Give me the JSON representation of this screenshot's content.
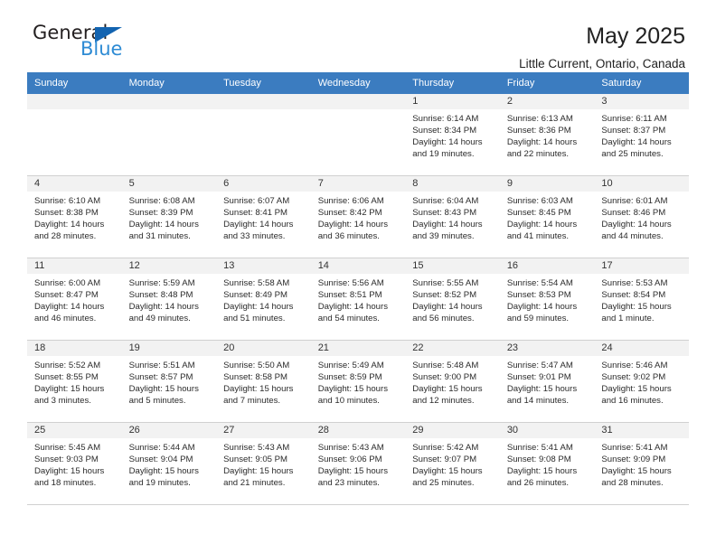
{
  "brand": {
    "name_part1": "General",
    "name_part2": "Blue",
    "triangle_color": "#1263b0",
    "blue_color": "#2e8bd4"
  },
  "header": {
    "title": "May 2025",
    "subtitle": "Little Current, Ontario, Canada"
  },
  "theme": {
    "header_row_bg": "#3b7cc0",
    "daynum_bg": "#f2f2f2",
    "grid_line": "#d0d0d0"
  },
  "weekday_headers": [
    "Sunday",
    "Monday",
    "Tuesday",
    "Wednesday",
    "Thursday",
    "Friday",
    "Saturday"
  ],
  "weeks": [
    [
      {
        "day": "",
        "sunrise": "",
        "sunset": "",
        "daylight1": "",
        "daylight2": ""
      },
      {
        "day": "",
        "sunrise": "",
        "sunset": "",
        "daylight1": "",
        "daylight2": ""
      },
      {
        "day": "",
        "sunrise": "",
        "sunset": "",
        "daylight1": "",
        "daylight2": ""
      },
      {
        "day": "",
        "sunrise": "",
        "sunset": "",
        "daylight1": "",
        "daylight2": ""
      },
      {
        "day": "1",
        "sunrise": "Sunrise: 6:14 AM",
        "sunset": "Sunset: 8:34 PM",
        "daylight1": "Daylight: 14 hours",
        "daylight2": "and 19 minutes."
      },
      {
        "day": "2",
        "sunrise": "Sunrise: 6:13 AM",
        "sunset": "Sunset: 8:36 PM",
        "daylight1": "Daylight: 14 hours",
        "daylight2": "and 22 minutes."
      },
      {
        "day": "3",
        "sunrise": "Sunrise: 6:11 AM",
        "sunset": "Sunset: 8:37 PM",
        "daylight1": "Daylight: 14 hours",
        "daylight2": "and 25 minutes."
      }
    ],
    [
      {
        "day": "4",
        "sunrise": "Sunrise: 6:10 AM",
        "sunset": "Sunset: 8:38 PM",
        "daylight1": "Daylight: 14 hours",
        "daylight2": "and 28 minutes."
      },
      {
        "day": "5",
        "sunrise": "Sunrise: 6:08 AM",
        "sunset": "Sunset: 8:39 PM",
        "daylight1": "Daylight: 14 hours",
        "daylight2": "and 31 minutes."
      },
      {
        "day": "6",
        "sunrise": "Sunrise: 6:07 AM",
        "sunset": "Sunset: 8:41 PM",
        "daylight1": "Daylight: 14 hours",
        "daylight2": "and 33 minutes."
      },
      {
        "day": "7",
        "sunrise": "Sunrise: 6:06 AM",
        "sunset": "Sunset: 8:42 PM",
        "daylight1": "Daylight: 14 hours",
        "daylight2": "and 36 minutes."
      },
      {
        "day": "8",
        "sunrise": "Sunrise: 6:04 AM",
        "sunset": "Sunset: 8:43 PM",
        "daylight1": "Daylight: 14 hours",
        "daylight2": "and 39 minutes."
      },
      {
        "day": "9",
        "sunrise": "Sunrise: 6:03 AM",
        "sunset": "Sunset: 8:45 PM",
        "daylight1": "Daylight: 14 hours",
        "daylight2": "and 41 minutes."
      },
      {
        "day": "10",
        "sunrise": "Sunrise: 6:01 AM",
        "sunset": "Sunset: 8:46 PM",
        "daylight1": "Daylight: 14 hours",
        "daylight2": "and 44 minutes."
      }
    ],
    [
      {
        "day": "11",
        "sunrise": "Sunrise: 6:00 AM",
        "sunset": "Sunset: 8:47 PM",
        "daylight1": "Daylight: 14 hours",
        "daylight2": "and 46 minutes."
      },
      {
        "day": "12",
        "sunrise": "Sunrise: 5:59 AM",
        "sunset": "Sunset: 8:48 PM",
        "daylight1": "Daylight: 14 hours",
        "daylight2": "and 49 minutes."
      },
      {
        "day": "13",
        "sunrise": "Sunrise: 5:58 AM",
        "sunset": "Sunset: 8:49 PM",
        "daylight1": "Daylight: 14 hours",
        "daylight2": "and 51 minutes."
      },
      {
        "day": "14",
        "sunrise": "Sunrise: 5:56 AM",
        "sunset": "Sunset: 8:51 PM",
        "daylight1": "Daylight: 14 hours",
        "daylight2": "and 54 minutes."
      },
      {
        "day": "15",
        "sunrise": "Sunrise: 5:55 AM",
        "sunset": "Sunset: 8:52 PM",
        "daylight1": "Daylight: 14 hours",
        "daylight2": "and 56 minutes."
      },
      {
        "day": "16",
        "sunrise": "Sunrise: 5:54 AM",
        "sunset": "Sunset: 8:53 PM",
        "daylight1": "Daylight: 14 hours",
        "daylight2": "and 59 minutes."
      },
      {
        "day": "17",
        "sunrise": "Sunrise: 5:53 AM",
        "sunset": "Sunset: 8:54 PM",
        "daylight1": "Daylight: 15 hours",
        "daylight2": "and 1 minute."
      }
    ],
    [
      {
        "day": "18",
        "sunrise": "Sunrise: 5:52 AM",
        "sunset": "Sunset: 8:55 PM",
        "daylight1": "Daylight: 15 hours",
        "daylight2": "and 3 minutes."
      },
      {
        "day": "19",
        "sunrise": "Sunrise: 5:51 AM",
        "sunset": "Sunset: 8:57 PM",
        "daylight1": "Daylight: 15 hours",
        "daylight2": "and 5 minutes."
      },
      {
        "day": "20",
        "sunrise": "Sunrise: 5:50 AM",
        "sunset": "Sunset: 8:58 PM",
        "daylight1": "Daylight: 15 hours",
        "daylight2": "and 7 minutes."
      },
      {
        "day": "21",
        "sunrise": "Sunrise: 5:49 AM",
        "sunset": "Sunset: 8:59 PM",
        "daylight1": "Daylight: 15 hours",
        "daylight2": "and 10 minutes."
      },
      {
        "day": "22",
        "sunrise": "Sunrise: 5:48 AM",
        "sunset": "Sunset: 9:00 PM",
        "daylight1": "Daylight: 15 hours",
        "daylight2": "and 12 minutes."
      },
      {
        "day": "23",
        "sunrise": "Sunrise: 5:47 AM",
        "sunset": "Sunset: 9:01 PM",
        "daylight1": "Daylight: 15 hours",
        "daylight2": "and 14 minutes."
      },
      {
        "day": "24",
        "sunrise": "Sunrise: 5:46 AM",
        "sunset": "Sunset: 9:02 PM",
        "daylight1": "Daylight: 15 hours",
        "daylight2": "and 16 minutes."
      }
    ],
    [
      {
        "day": "25",
        "sunrise": "Sunrise: 5:45 AM",
        "sunset": "Sunset: 9:03 PM",
        "daylight1": "Daylight: 15 hours",
        "daylight2": "and 18 minutes."
      },
      {
        "day": "26",
        "sunrise": "Sunrise: 5:44 AM",
        "sunset": "Sunset: 9:04 PM",
        "daylight1": "Daylight: 15 hours",
        "daylight2": "and 19 minutes."
      },
      {
        "day": "27",
        "sunrise": "Sunrise: 5:43 AM",
        "sunset": "Sunset: 9:05 PM",
        "daylight1": "Daylight: 15 hours",
        "daylight2": "and 21 minutes."
      },
      {
        "day": "28",
        "sunrise": "Sunrise: 5:43 AM",
        "sunset": "Sunset: 9:06 PM",
        "daylight1": "Daylight: 15 hours",
        "daylight2": "and 23 minutes."
      },
      {
        "day": "29",
        "sunrise": "Sunrise: 5:42 AM",
        "sunset": "Sunset: 9:07 PM",
        "daylight1": "Daylight: 15 hours",
        "daylight2": "and 25 minutes."
      },
      {
        "day": "30",
        "sunrise": "Sunrise: 5:41 AM",
        "sunset": "Sunset: 9:08 PM",
        "daylight1": "Daylight: 15 hours",
        "daylight2": "and 26 minutes."
      },
      {
        "day": "31",
        "sunrise": "Sunrise: 5:41 AM",
        "sunset": "Sunset: 9:09 PM",
        "daylight1": "Daylight: 15 hours",
        "daylight2": "and 28 minutes."
      }
    ]
  ]
}
